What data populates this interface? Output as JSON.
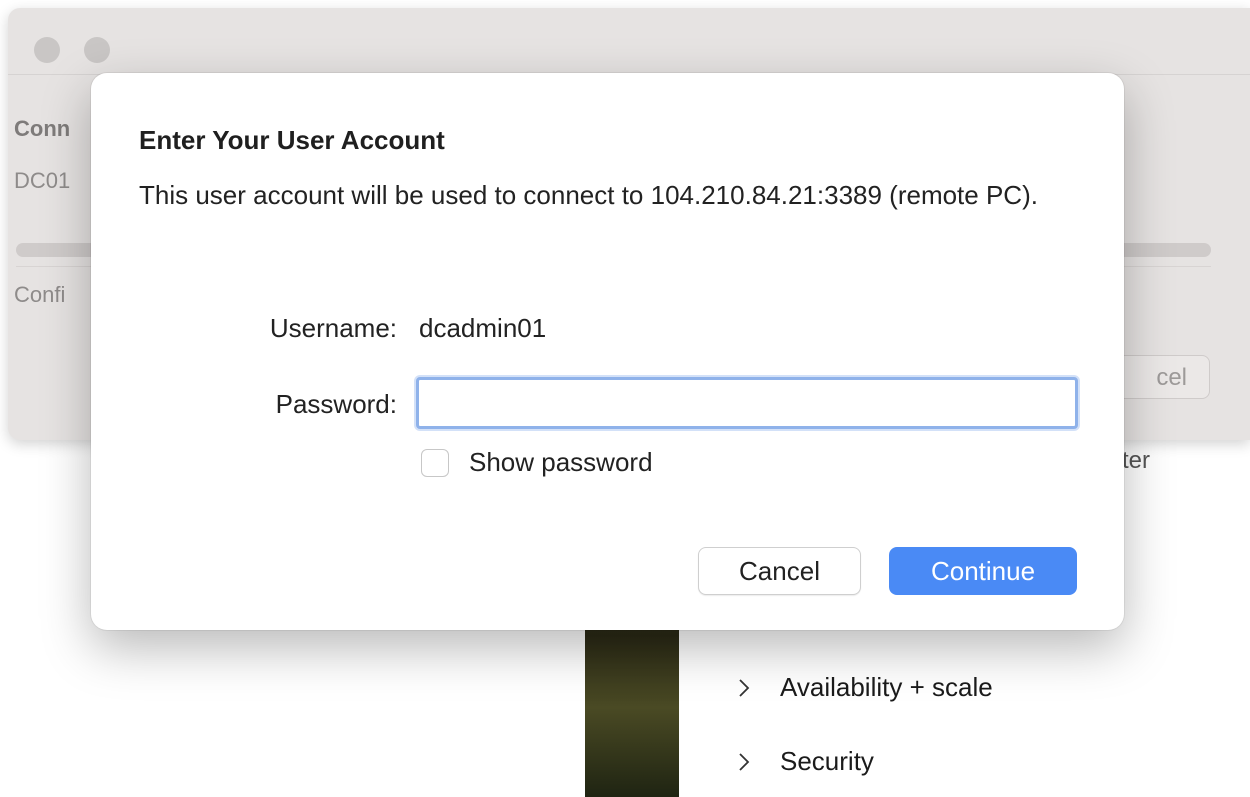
{
  "background_window": {
    "labels": {
      "conn": "Conn",
      "dc01": "DC01",
      "confi": "Confi"
    },
    "cancel_button_partial": "cel"
  },
  "background_page": {
    "partial_text": "ter",
    "nav_items": [
      {
        "label": "Availability + scale",
        "icon": "chevron-right-icon"
      },
      {
        "label": "Security",
        "icon": "chevron-right-icon"
      }
    ]
  },
  "dialog": {
    "title": "Enter Your User Account",
    "message": "This user account will be used to connect to 104.210.84.21:3389 (remote PC).",
    "username_label": "Username:",
    "username_value": "dcadmin01",
    "password_label": "Password:",
    "password_value": "",
    "show_password_label": "Show password",
    "show_password_checked": false,
    "cancel_label": "Cancel",
    "continue_label": "Continue",
    "accent_color": "#4a8af5"
  }
}
